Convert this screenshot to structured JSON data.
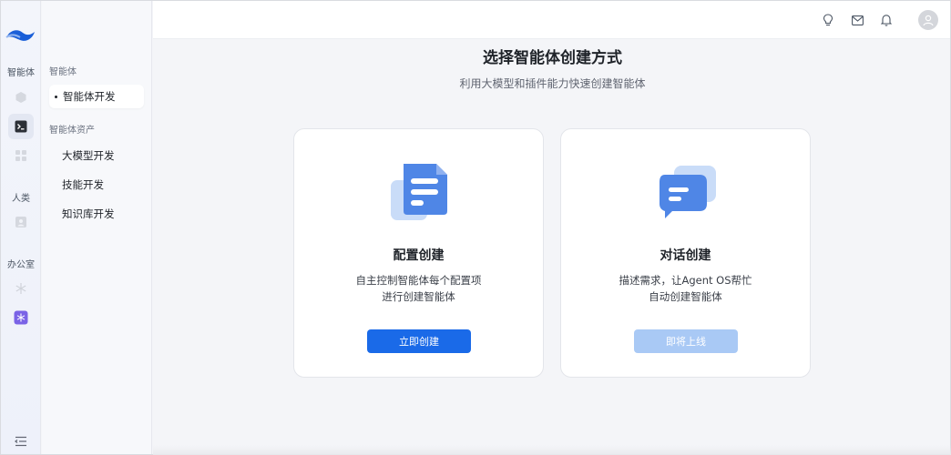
{
  "rail": {
    "section_agent": "智能体",
    "section_human": "人类",
    "section_office": "办公室"
  },
  "subnav": {
    "heading_agent": "智能体",
    "active_item": "智能体开发",
    "heading_assets": "智能体资产",
    "items": [
      "大模型开发",
      "技能开发",
      "知识库开发"
    ]
  },
  "main": {
    "title": "选择智能体创建方式",
    "subtitle": "利用大模型和插件能力快速创建智能体"
  },
  "cards": [
    {
      "title": "配置创建",
      "desc_line1": "自主控制智能体每个配置项",
      "desc_line2": "进行创建智能体",
      "button": "立即创建",
      "icon": "document-icon"
    },
    {
      "title": "对话创建",
      "desc_line1": "描述需求，让Agent OS帮忙",
      "desc_line2": "自动创建智能体",
      "button": "即将上线",
      "icon": "chat-bubbles-icon"
    }
  ],
  "colors": {
    "primary": "#1a6ae8",
    "primary_disabled": "#a9c9f5",
    "background": "#f4f5f8"
  }
}
